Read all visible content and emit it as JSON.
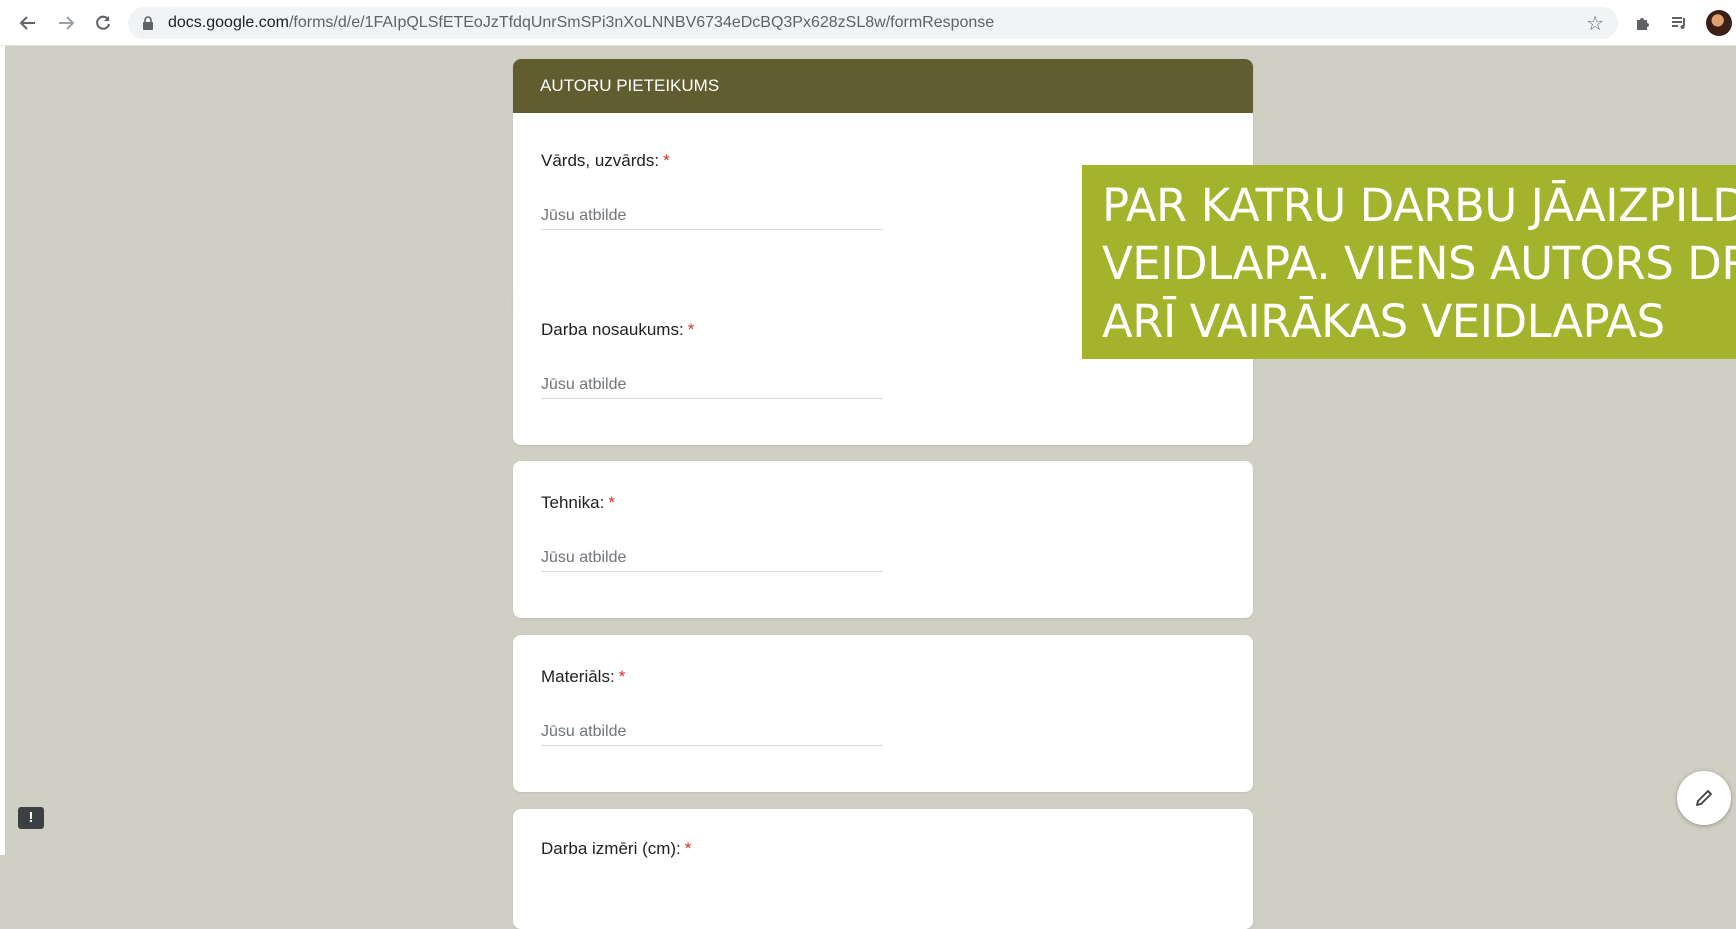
{
  "browser": {
    "url_host": "docs.google.com",
    "url_path": "/forms/d/e/1FAIpQLSfETEoJzTfdqUnrSmSPi3nXoLNNBV6734eDcBQ3Px628zSL8w/formResponse"
  },
  "form": {
    "section_title": "AUTORU PIETEIKUMS",
    "required_mark": "*",
    "questions": [
      {
        "label": "Vārds, uzvārds:",
        "placeholder": "Jūsu atbilde"
      },
      {
        "label": "Darba nosaukums:",
        "placeholder": "Jūsu atbilde"
      },
      {
        "label": "Tehnika:",
        "placeholder": "Jūsu atbilde"
      },
      {
        "label": "Materiāls:",
        "placeholder": "Jūsu atbilde"
      },
      {
        "label": "Darba izmēri (cm):"
      }
    ]
  },
  "banner": {
    "text": "PAR KATRU DARBU JĀAIZPILDA\nVEIDLAPA. VIENS AUTORS DRĪKST\nARĪ VAIRĀKAS VEIDLAPAS"
  },
  "colors": {
    "page_bg": "#d0cfc3",
    "header_band": "#625d31",
    "banner_bg": "#a3b32b",
    "required": "#d93025"
  },
  "icons": {
    "back": "arrow-left",
    "forward": "arrow-right",
    "reload": "reload",
    "lock": "lock",
    "bookmark": "star",
    "extensions": "puzzle",
    "media": "playlist",
    "feedback": "exclamation",
    "edit": "pencil"
  }
}
